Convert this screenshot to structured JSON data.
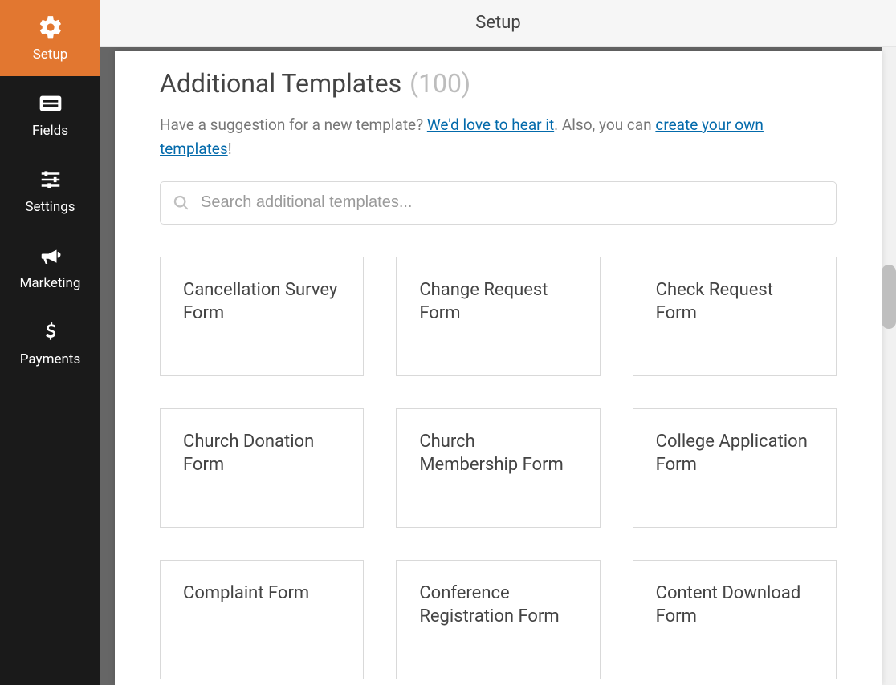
{
  "sidebar": {
    "items": [
      {
        "label": "Setup",
        "icon": "gear-icon",
        "active": true
      },
      {
        "label": "Fields",
        "icon": "card-icon",
        "active": false
      },
      {
        "label": "Settings",
        "icon": "sliders-icon",
        "active": false
      },
      {
        "label": "Marketing",
        "icon": "bullhorn-icon",
        "active": false
      },
      {
        "label": "Payments",
        "icon": "dollar-icon",
        "active": false
      }
    ]
  },
  "topbar": {
    "title": "Setup"
  },
  "content": {
    "heading": "Additional Templates",
    "count": "(100)",
    "intro_part1": "Have a suggestion for a new template? ",
    "intro_link1": "We'd love to hear it",
    "intro_part2": ". Also, you can ",
    "intro_link2": "create your own templates",
    "intro_part3": "!",
    "search": {
      "placeholder": "Search additional templates..."
    },
    "templates": [
      {
        "title": "Cancellation Survey Form"
      },
      {
        "title": "Change Request Form"
      },
      {
        "title": "Check Request Form"
      },
      {
        "title": "Church Donation Form"
      },
      {
        "title": "Church Membership Form"
      },
      {
        "title": "College Application Form"
      },
      {
        "title": "Complaint Form"
      },
      {
        "title": "Conference Registration Form"
      },
      {
        "title": "Content Download Form"
      }
    ]
  }
}
